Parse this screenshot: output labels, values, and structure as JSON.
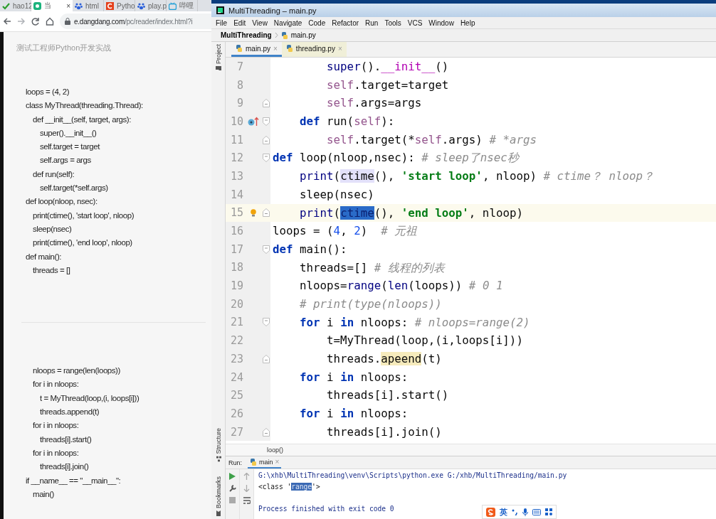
{
  "browser": {
    "tabs": [
      {
        "label": "hao12",
        "kind": "check",
        "selected": false
      },
      {
        "label": "当",
        "kind": "book",
        "selected": true,
        "close": "×"
      },
      {
        "label": "html",
        "kind": "paw",
        "selected": false
      },
      {
        "label": "Pytho",
        "kind": "c",
        "selected": false
      },
      {
        "label": "play.p",
        "kind": "paw",
        "selected": false
      },
      {
        "label": "哔哩",
        "kind": "tv",
        "selected": false
      }
    ],
    "url_host": "e.dangdang.com",
    "url_path": "/pc/reader/index.html?i",
    "page": {
      "title": "测试工程师Python开发实战",
      "sections": [
        {
          "lines": [
            {
              "text": "loops = (4, 2)"
            },
            {
              "text": "class MyThread(threading.Thread):"
            },
            {
              "text": "def __init__(self, target, args):",
              "children": [
                {
                  "text": "super().__init__()"
                },
                {
                  "text": "self.target = target"
                },
                {
                  "text": "self.args = args"
                }
              ]
            },
            {
              "text": "def run(self):",
              "children": [
                {
                  "text": "self.target(*self.args)"
                }
              ]
            },
            {
              "text": "def loop(nloop, nsec):"
            },
            {
              "text": "print(ctime(), 'start loop', nloop)"
            },
            {
              "text": "sleep(nsec)"
            },
            {
              "text": "print(ctime(), 'end loop', nloop)"
            },
            {
              "text": "def main():"
            },
            {
              "text": "threads = []"
            }
          ]
        },
        {
          "lines": [
            {
              "text": "nloops = range(len(loops))"
            },
            {
              "text": "for i in nloops:",
              "children": [
                {
                  "text": "t = MyThread(loop,(i, loops[i]))"
                },
                {
                  "text": "threads.append(t)"
                }
              ]
            },
            {
              "text": "for i in nloops:",
              "children": [
                {
                  "text": "threads[i].start()"
                }
              ]
            },
            {
              "text": "for i in nloops:",
              "children": [
                {
                  "text": "threads[i].join()"
                }
              ]
            },
            {
              "text": "if __name__ == \"__main__\":"
            },
            {
              "text": "main()"
            }
          ]
        }
      ]
    }
  },
  "ide": {
    "title": "MultiThreading – main.py",
    "menu": [
      "File",
      "Edit",
      "View",
      "Navigate",
      "Code",
      "Refactor",
      "Run",
      "Tools",
      "VCS",
      "Window",
      "Help"
    ],
    "breadcrumb": {
      "project": "MultiThreading",
      "file": "main.py"
    },
    "side_tools": {
      "top": [
        "Project"
      ],
      "bottom": [
        "Structure",
        "Bookmarks"
      ]
    },
    "tabs": [
      {
        "label": "main.py",
        "selected": true,
        "close": "×"
      },
      {
        "label": "threading.py",
        "selected": false,
        "close": "×"
      }
    ],
    "lines": [
      {
        "number": "7",
        "tokens": [
          {
            "text": "        super",
            "kind": "builtin"
          },
          {
            "text": "().",
            "kind": "plain"
          },
          {
            "text": "__init__",
            "kind": "magic"
          },
          {
            "text": "()",
            "kind": "plain"
          }
        ]
      },
      {
        "number": "8",
        "tokens": [
          {
            "text": "        self",
            "kind": "self"
          },
          {
            "text": ".target=target",
            "kind": "plain"
          }
        ]
      },
      {
        "number": "9",
        "fold_end": true,
        "tokens": [
          {
            "text": "        self",
            "kind": "self"
          },
          {
            "text": ".args=args",
            "kind": "plain"
          }
        ]
      },
      {
        "number": "10",
        "fold_start": true,
        "override_marker": true,
        "tokens": [
          {
            "text": "    def",
            "kind": "keyword"
          },
          {
            "text": " run(",
            "kind": "plain"
          },
          {
            "text": "self",
            "kind": "self"
          },
          {
            "text": "):",
            "kind": "plain"
          }
        ]
      },
      {
        "number": "11",
        "fold_end": true,
        "tokens": [
          {
            "text": "        self",
            "kind": "self"
          },
          {
            "text": ".target(*",
            "kind": "plain"
          },
          {
            "text": "self",
            "kind": "self"
          },
          {
            "text": ".args) ",
            "kind": "plain"
          },
          {
            "text": "# *args",
            "kind": "comment"
          }
        ]
      },
      {
        "number": "12",
        "fold_start": true,
        "tokens": [
          {
            "text": "def",
            "kind": "keyword"
          },
          {
            "text": " loop(nloop,nsec): ",
            "kind": "plain"
          },
          {
            "text": "# sleep了nsec秒",
            "kind": "comment"
          }
        ]
      },
      {
        "number": "13",
        "tokens": [
          {
            "text": "    print",
            "kind": "builtin"
          },
          {
            "text": "(",
            "kind": "plain"
          },
          {
            "text": "ctime",
            "kind": "usage"
          },
          {
            "text": "(), ",
            "kind": "plain"
          },
          {
            "text": "'start loop'",
            "kind": "string"
          },
          {
            "text": ", nloop) ",
            "kind": "plain"
          },
          {
            "text": "# ctime？ nloop？",
            "kind": "comment"
          }
        ]
      },
      {
        "number": "14",
        "tokens": [
          {
            "text": "    sleep(nsec)",
            "kind": "plain"
          }
        ]
      },
      {
        "number": "15",
        "fold_end": true,
        "intention_bulb": true,
        "current": true,
        "tokens": [
          {
            "text": "    print",
            "kind": "builtin"
          },
          {
            "text": "(",
            "kind": "plain"
          },
          {
            "text": "ctime",
            "kind": "selection"
          },
          {
            "text": "(), ",
            "kind": "plain"
          },
          {
            "text": "'end loop'",
            "kind": "string"
          },
          {
            "text": ", nloop)",
            "kind": "plain"
          }
        ]
      },
      {
        "number": "16",
        "tokens": [
          {
            "text": "loops = (",
            "kind": "plain"
          },
          {
            "text": "4",
            "kind": "number"
          },
          {
            "text": ", ",
            "kind": "plain"
          },
          {
            "text": "2",
            "kind": "number"
          },
          {
            "text": ")  ",
            "kind": "plain"
          },
          {
            "text": "# 元祖",
            "kind": "comment"
          }
        ]
      },
      {
        "number": "17",
        "fold_start": true,
        "tokens": [
          {
            "text": "def",
            "kind": "keyword"
          },
          {
            "text": " main():",
            "kind": "plain"
          }
        ]
      },
      {
        "number": "18",
        "tokens": [
          {
            "text": "    threads=[] ",
            "kind": "plain"
          },
          {
            "text": "# 线程的列表",
            "kind": "comment"
          }
        ]
      },
      {
        "number": "19",
        "tokens": [
          {
            "text": "    nloops=",
            "kind": "plain"
          },
          {
            "text": "range",
            "kind": "builtin"
          },
          {
            "text": "(",
            "kind": "plain"
          },
          {
            "text": "len",
            "kind": "builtin"
          },
          {
            "text": "(loops)) ",
            "kind": "plain"
          },
          {
            "text": "# 0 1",
            "kind": "comment"
          }
        ]
      },
      {
        "number": "20",
        "tokens": [
          {
            "text": "    # print(type(nloops))",
            "kind": "comment"
          }
        ]
      },
      {
        "number": "21",
        "fold_start": true,
        "tokens": [
          {
            "text": "    for",
            "kind": "keyword"
          },
          {
            "text": " i ",
            "kind": "plain"
          },
          {
            "text": "in",
            "kind": "keyword"
          },
          {
            "text": " nloops: ",
            "kind": "plain"
          },
          {
            "text": "# nloops=range(2)",
            "kind": "comment"
          }
        ]
      },
      {
        "number": "22",
        "tokens": [
          {
            "text": "        t=MyThread(loop,(i,loops[i]))",
            "kind": "plain"
          }
        ]
      },
      {
        "number": "23",
        "fold_end": true,
        "tokens": [
          {
            "text": "        threads.",
            "kind": "plain"
          },
          {
            "text": "apeend",
            "kind": "warning"
          },
          {
            "text": "(t)",
            "kind": "plain"
          }
        ]
      },
      {
        "number": "24",
        "tokens": [
          {
            "text": "    for",
            "kind": "keyword"
          },
          {
            "text": " i ",
            "kind": "plain"
          },
          {
            "text": "in",
            "kind": "keyword"
          },
          {
            "text": " nloops:",
            "kind": "plain"
          }
        ]
      },
      {
        "number": "25",
        "tokens": [
          {
            "text": "        threads[i].start()",
            "kind": "plain"
          }
        ]
      },
      {
        "number": "26",
        "tokens": [
          {
            "text": "    for",
            "kind": "keyword"
          },
          {
            "text": " i ",
            "kind": "plain"
          },
          {
            "text": "in",
            "kind": "keyword"
          },
          {
            "text": " nloops:",
            "kind": "plain"
          }
        ]
      },
      {
        "number": "27",
        "fold_end": true,
        "tokens": [
          {
            "text": "        threads[i].join()",
            "kind": "plain"
          }
        ]
      }
    ],
    "context": "loop()",
    "run": {
      "label": "Run:",
      "tab": "main",
      "tab_close": "×",
      "output": [
        {
          "kind": "system",
          "tokens": [
            {
              "text": "G:\\xhb\\MultiThreading\\venv\\Scripts\\python.exe G:/xhb/MultiThreading/main.py",
              "kind": "plain"
            }
          ]
        },
        {
          "kind": "stdout",
          "tokens": [
            {
              "text": "<class '",
              "kind": "plain"
            },
            {
              "text": "range",
              "kind": "selection"
            },
            {
              "text": "'>",
              "kind": "plain"
            }
          ]
        },
        {
          "kind": "blank"
        },
        {
          "kind": "system",
          "tokens": [
            {
              "text": "Process finished with exit code 0",
              "kind": "plain"
            }
          ]
        }
      ]
    },
    "ime": {
      "mode": "英"
    }
  }
}
